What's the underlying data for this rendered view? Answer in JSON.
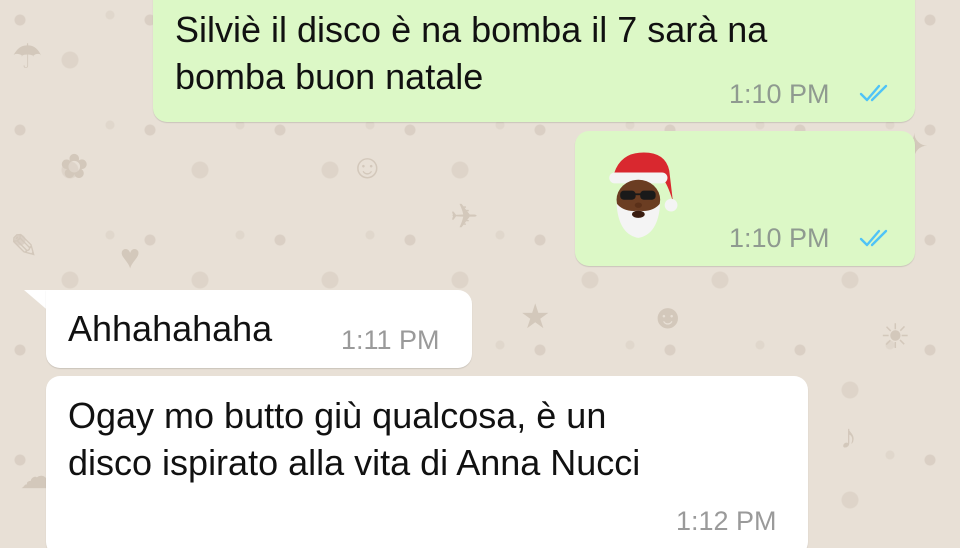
{
  "messages": [
    {
      "direction": "outgoing",
      "lines": [
        "Silviè il disco è na bomba il 7 sarà na",
        "bomba buon natale"
      ],
      "time": "1:10 PM",
      "status": "read"
    },
    {
      "direction": "outgoing",
      "sticker": "santa-emoji",
      "time": "1:10 PM",
      "status": "read"
    },
    {
      "direction": "incoming",
      "lines": [
        "Ahhahahaha"
      ],
      "time": "1:11 PM"
    },
    {
      "direction": "incoming",
      "lines": [
        "Ogay mo butto giù qualcosa, è un",
        "disco ispirato alla vita di Anna Nucci"
      ],
      "time": "1:12 PM"
    }
  ],
  "colors": {
    "outgoing_bubble": "#dcf8c6",
    "incoming_bubble": "#ffffff",
    "wallpaper": "#e8e0d6",
    "read_ticks": "#4fc3f7"
  }
}
